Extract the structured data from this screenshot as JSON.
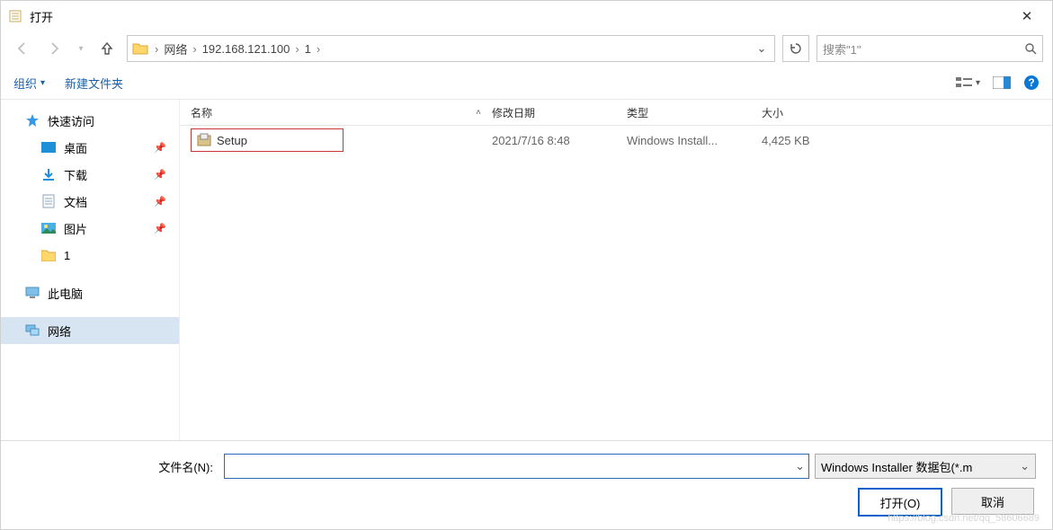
{
  "window": {
    "title": "打开"
  },
  "nav": {
    "path": {
      "seg1": "网络",
      "seg2": "192.168.121.100",
      "seg3": "1"
    },
    "search_placeholder": "搜索\"1\""
  },
  "toolbar": {
    "organize": "组织",
    "newfolder": "新建文件夹"
  },
  "sidebar": {
    "quick_access": "快速访问",
    "desktop": "桌面",
    "downloads": "下载",
    "documents": "文档",
    "pictures": "图片",
    "folder1": "1",
    "this_pc": "此电脑",
    "network": "网络"
  },
  "columns": {
    "name": "名称",
    "date": "修改日期",
    "type": "类型",
    "size": "大小"
  },
  "files": [
    {
      "name": "Setup",
      "date": "2021/7/16 8:48",
      "type": "Windows Install...",
      "size": "4,425 KB"
    }
  ],
  "bottom": {
    "filename_label": "文件名(N):",
    "filename_value": "",
    "filter": "Windows Installer 数据包(*.m",
    "open": "打开(O)",
    "cancel": "取消"
  },
  "watermark": "https://blog.csdn.net/qq_58606689"
}
